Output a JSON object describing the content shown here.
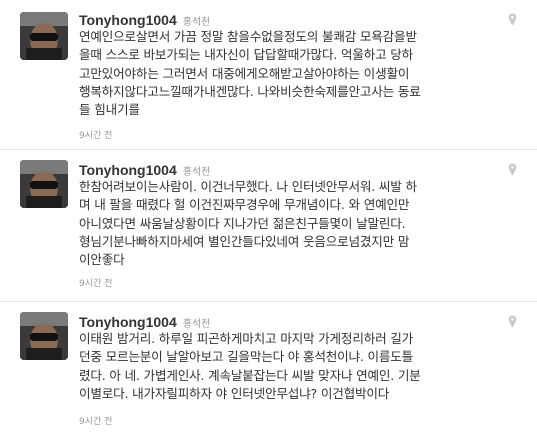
{
  "tweets": [
    {
      "name": "Tonyhong1004",
      "handle": "홍석천",
      "lines": [
        "연예인으로살면서 가끔 정말 참을수없을정도의 불쾌감 모욕감을받",
        "을때 스스로 바보가되는 내자신이 답답할때가많다. 억울하고 당하",
        "고만있어야하는 그러면서 대중에게오해받고살아야하는 이생활이",
        "행복하지않다고느낄때가내겐많다. 나와비슷한숙제를안고사는 동료",
        "들 힘내기를"
      ],
      "time": "9시간 전"
    },
    {
      "name": "Tonyhong1004",
      "handle": "홍석천",
      "lines": [
        "한참어려보이는사람이. 이건너무했다. 나 인터넷안무서워. 씨발 하",
        "며 내 팔을 때렸다 헐 이건진짜무경우에 무개념이다. 와 연예인만",
        "아니였다면 싸움날상황이다 지나가던 젊은친구들몇이 날말린다.",
        "형님기분나빠하지마세여 별인간들다있네여 웃음으로넘겼지만 맘",
        "이안좋다"
      ],
      "time": "9시간 전"
    },
    {
      "name": "Tonyhong1004",
      "handle": "홍석천",
      "lines": [
        "이태원 밤거리. 하루일 피곤하게마치고 마지막 가게정리하러 길가",
        "던중 모르는분이 날알아보고 길을막는다 야 홍석천이냐. 이름도틀",
        "렸다. 아 네. 가볍게인사. 계속날붙잡는다 씨발 맞자나 연예인. 기분",
        "이별로다. 내가자릴피하자 야 인터넷안무섭냐? 이건협박이다"
      ],
      "time": "9시간 전"
    }
  ]
}
